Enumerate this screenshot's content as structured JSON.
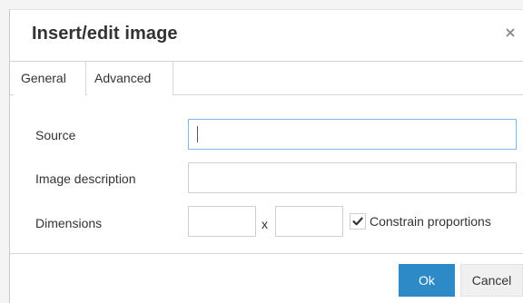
{
  "dialog": {
    "title": "Insert/edit image",
    "close_icon": "close-icon"
  },
  "tabs": [
    {
      "label": "General",
      "active": true
    },
    {
      "label": "Advanced",
      "active": false
    }
  ],
  "form": {
    "source": {
      "label": "Source",
      "value": "",
      "placeholder": ""
    },
    "description": {
      "label": "Image description",
      "value": "",
      "placeholder": ""
    },
    "dimensions": {
      "label": "Dimensions",
      "width_value": "",
      "height_value": "",
      "separator": "x"
    },
    "constrain": {
      "label": "Constrain proportions",
      "checked": true
    }
  },
  "footer": {
    "ok_label": "Ok",
    "cancel_label": "Cancel"
  },
  "colors": {
    "primary_button": "#2d8ac7",
    "focus_border": "#7fb6e6"
  }
}
